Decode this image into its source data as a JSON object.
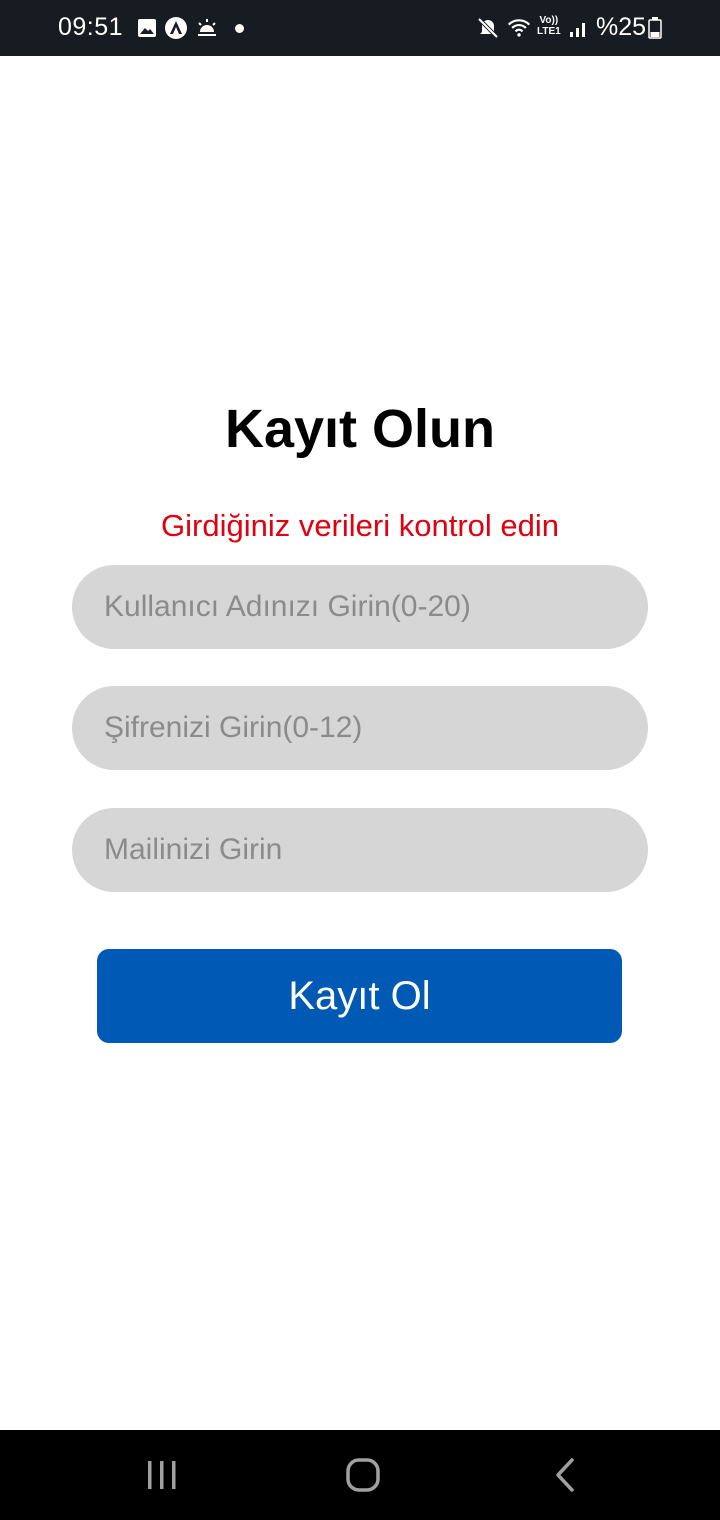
{
  "status_bar": {
    "time": "09:51",
    "volte_line1": "Vo))",
    "volte_line2": "LTE1",
    "battery": "%25",
    "icons": [
      "image-icon",
      "app-icon",
      "weather-icon",
      "notification-dot",
      "mute-icon",
      "wifi-icon",
      "volte-icon",
      "signal-icon",
      "battery-icon"
    ]
  },
  "register": {
    "title": "Kayıt Olun",
    "error": "Girdiğiniz verileri kontrol edin",
    "username_placeholder": "Kullanıcı Adınızı Girin(0-20)",
    "password_placeholder": "Şifrenizi Girin(0-12)",
    "email_placeholder": "Mailinizi Girin",
    "button_label": "Kayıt Ol"
  },
  "nav_bar": {
    "icons": [
      "recent-apps-icon",
      "home-icon",
      "back-icon"
    ]
  },
  "colors": {
    "accent": "#0059b5",
    "error": "#e0000f",
    "input_bg": "#d6d6d6",
    "status_bg": "#171b22"
  }
}
